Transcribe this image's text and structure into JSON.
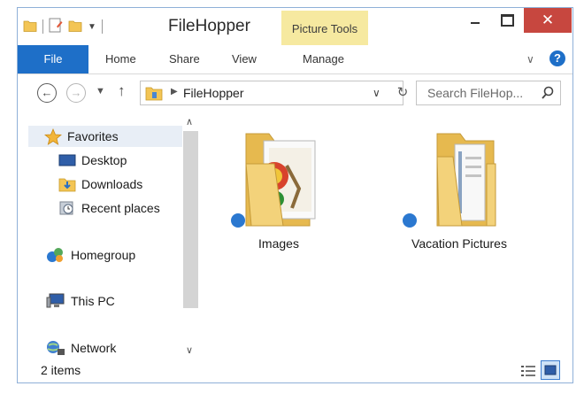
{
  "window": {
    "title": "FileHopper",
    "context_tab_label": "Picture Tools",
    "close_glyph": "✕"
  },
  "ribbon": {
    "tabs": [
      {
        "label": "File"
      },
      {
        "label": "Home"
      },
      {
        "label": "Share"
      },
      {
        "label": "View"
      },
      {
        "label": "Manage"
      }
    ],
    "help_glyph": "?"
  },
  "address_bar": {
    "path": "FileHopper",
    "search_placeholder": "Search FileHop..."
  },
  "navigation": {
    "items": [
      {
        "label": "Favorites",
        "icon": "star-icon"
      },
      {
        "label": "Desktop",
        "icon": "desktop-icon"
      },
      {
        "label": "Downloads",
        "icon": "downloads-icon"
      },
      {
        "label": "Recent places",
        "icon": "recent-places-icon"
      },
      {
        "label": "Homegroup",
        "icon": "homegroup-icon"
      },
      {
        "label": "This PC",
        "icon": "computer-icon"
      },
      {
        "label": "Network",
        "icon": "network-icon"
      }
    ]
  },
  "content": {
    "items": [
      {
        "name": "Images",
        "icon": "picture-folder-icon"
      },
      {
        "name": "Vacation Pictures",
        "icon": "documents-folder-icon"
      }
    ]
  },
  "status_bar": {
    "item_count": "2 items"
  },
  "colors": {
    "accent": "#1e6fc8",
    "context_tab": "#f6e9a0",
    "close_button": "#c7473f",
    "folder": "#f3d27a"
  }
}
